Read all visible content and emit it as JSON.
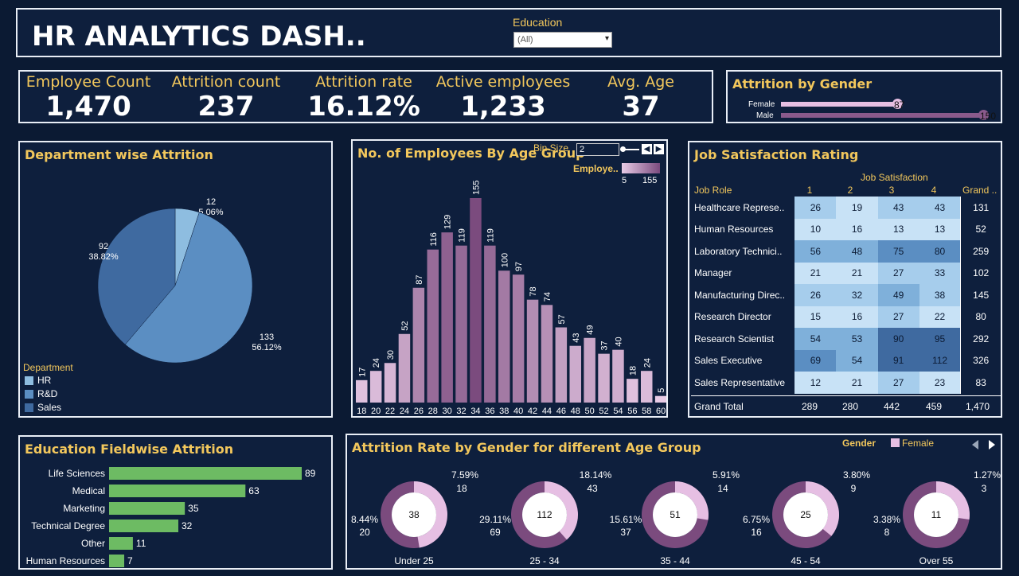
{
  "header": {
    "title": "HR ANALYTICS DASH..",
    "filter_label": "Education",
    "filter_value": "(All)"
  },
  "kpis": [
    {
      "label": "Employee Count",
      "value": "1,470"
    },
    {
      "label": "Attrition count",
      "value": "237"
    },
    {
      "label": "Attrition rate",
      "value": "16.12%"
    },
    {
      "label": "Active employees",
      "value": "1,233"
    },
    {
      "label": "Avg. Age",
      "value": "37"
    }
  ],
  "gender_attrition": {
    "title": "Attrition by Gender",
    "rows": [
      {
        "label": "Female",
        "value": 87,
        "value_text": "87"
      },
      {
        "label": "Male",
        "value": 150,
        "value_text": "150"
      }
    ],
    "max": 150
  },
  "department": {
    "title": "Department wise Attrition",
    "legend_title": "Department",
    "slices": [
      {
        "name": "HR",
        "value": 12,
        "label": "12",
        "pct": "5.06%",
        "color": "#8ebde0"
      },
      {
        "name": "R&D",
        "value": 133,
        "label": "133",
        "pct": "56.12%",
        "color": "#5b8ec2"
      },
      {
        "name": "Sales",
        "value": 92,
        "label": "92",
        "pct": "38.82%",
        "color": "#3f6aa0"
      }
    ]
  },
  "age_group": {
    "title": "No. of Employees By Age Group",
    "bin_label": "Bin Size",
    "bin_value": "2",
    "legend_title": "Employe..",
    "legend_min": "5",
    "legend_max": "155"
  },
  "job_satisfaction": {
    "title": "Job Satisfaction Rating",
    "column_header": "Job Satisfaction",
    "row_header": "Job Role",
    "columns": [
      "1",
      "2",
      "3",
      "4"
    ],
    "grand_label": "Grand ..",
    "grand_total_label": "Grand Total",
    "rows": [
      {
        "role": "Healthcare Represe..",
        "values": [
          "26",
          "19",
          "43",
          "43"
        ],
        "total": "131"
      },
      {
        "role": "Human Resources",
        "values": [
          "10",
          "16",
          "13",
          "13"
        ],
        "total": "52"
      },
      {
        "role": "Laboratory Technici..",
        "values": [
          "56",
          "48",
          "75",
          "80"
        ],
        "total": "259"
      },
      {
        "role": "Manager",
        "values": [
          "21",
          "21",
          "27",
          "33"
        ],
        "total": "102"
      },
      {
        "role": "Manufacturing Direc..",
        "values": [
          "26",
          "32",
          "49",
          "38"
        ],
        "total": "145"
      },
      {
        "role": "Research Director",
        "values": [
          "15",
          "16",
          "27",
          "22"
        ],
        "total": "80"
      },
      {
        "role": "Research Scientist",
        "values": [
          "54",
          "53",
          "90",
          "95"
        ],
        "total": "292"
      },
      {
        "role": "Sales Executive",
        "values": [
          "69",
          "54",
          "91",
          "112"
        ],
        "total": "326"
      },
      {
        "role": "Sales Representative",
        "values": [
          "12",
          "21",
          "27",
          "23"
        ],
        "total": "83"
      }
    ],
    "grand_totals": [
      "289",
      "280",
      "442",
      "459"
    ],
    "grand_total": "1,470"
  },
  "education_field": {
    "title": "Education Fieldwise Attrition",
    "bars": [
      {
        "label": "Life Sciences",
        "value": 89,
        "value_text": "89"
      },
      {
        "label": "Medical",
        "value": 63,
        "value_text": "63"
      },
      {
        "label": "Marketing",
        "value": 35,
        "value_text": "35"
      },
      {
        "label": "Technical Degree",
        "value": 32,
        "value_text": "32"
      },
      {
        "label": "Other",
        "value": 11,
        "value_text": "11"
      },
      {
        "label": "Human Resources",
        "value": 7,
        "value_text": "7"
      }
    ],
    "bar_color": "#6dbb63"
  },
  "gender_age": {
    "title": "Attrition Rate by Gender for different Age Group",
    "legend_title": "Gender",
    "legend_item": "Female",
    "female_color": "#e6bfe3",
    "other_color": "#7b4b7e",
    "groups": [
      {
        "name": "Under 25",
        "center": "38",
        "female_pct": "7.59%",
        "female_n": "18",
        "male_pct": "8.44%",
        "male_n": "20",
        "female_share": 0.474
      },
      {
        "name": "25 - 34",
        "center": "112",
        "female_pct": "18.14%",
        "female_n": "43",
        "male_pct": "29.11%",
        "male_n": "69",
        "female_share": 0.384
      },
      {
        "name": "35 - 44",
        "center": "51",
        "female_pct": "5.91%",
        "female_n": "14",
        "male_pct": "15.61%",
        "male_n": "37",
        "female_share": 0.275
      },
      {
        "name": "45 - 54",
        "center": "25",
        "female_pct": "3.80%",
        "female_n": "9",
        "male_pct": "6.75%",
        "male_n": "16",
        "female_share": 0.36
      },
      {
        "name": "Over 55",
        "center": "11",
        "female_pct": "1.27%",
        "female_n": "3",
        "male_pct": "3.38%",
        "male_n": "8",
        "female_share": 0.273
      }
    ]
  },
  "chart_data": [
    {
      "type": "bar",
      "title": "No. of Employees By Age Group",
      "categories": [
        "18",
        "20",
        "22",
        "24",
        "26",
        "28",
        "30",
        "32",
        "34",
        "36",
        "38",
        "40",
        "42",
        "44",
        "46",
        "48",
        "50",
        "52",
        "54",
        "56",
        "58",
        "60"
      ],
      "values": [
        17,
        24,
        30,
        52,
        87,
        116,
        129,
        119,
        155,
        119,
        100,
        97,
        78,
        74,
        57,
        43,
        49,
        37,
        40,
        18,
        24,
        5
      ],
      "ylim": [
        0,
        155
      ]
    },
    {
      "type": "pie",
      "title": "Department wise Attrition",
      "categories": [
        "HR",
        "R&D",
        "Sales"
      ],
      "values": [
        12,
        133,
        92
      ]
    },
    {
      "type": "bar",
      "title": "Education Fieldwise Attrition",
      "categories": [
        "Life Sciences",
        "Medical",
        "Marketing",
        "Technical Degree",
        "Other",
        "Human Resources"
      ],
      "values": [
        89,
        63,
        35,
        32,
        11,
        7
      ]
    }
  ]
}
